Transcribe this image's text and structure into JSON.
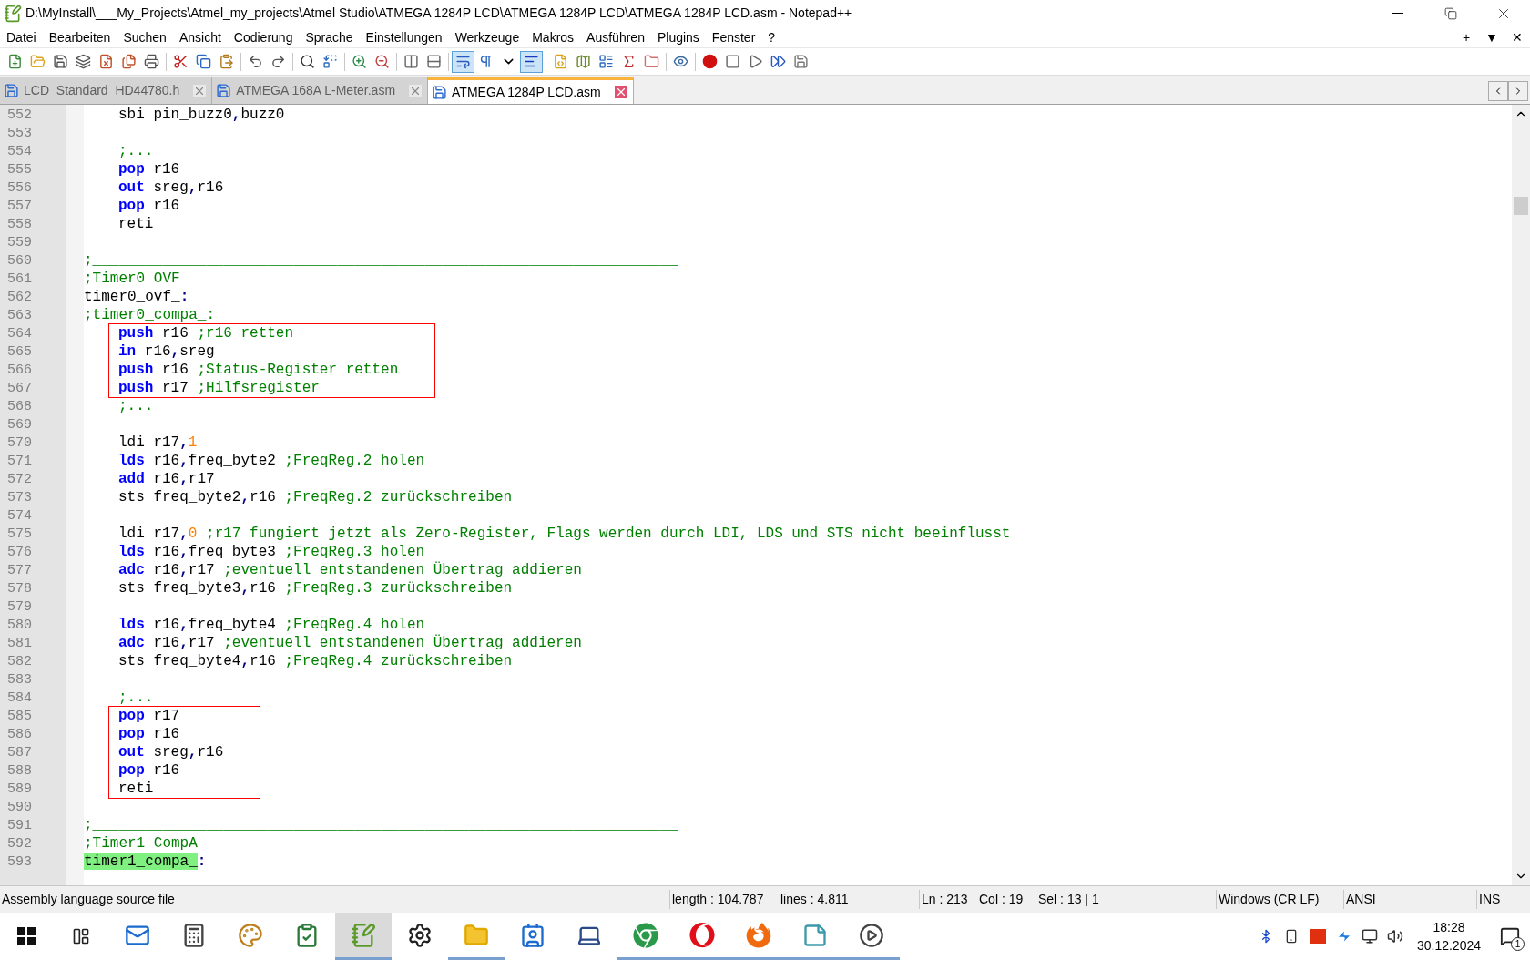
{
  "window": {
    "title": "D:\\MyInstall\\___My_Projects\\Atmel_my_projects\\Atmel Studio\\ATMEGA 1284P LCD\\ATMEGA 1284P LCD\\ATMEGA 1284P LCD.asm - Notepad++"
  },
  "menu": [
    "Datei",
    "Bearbeiten",
    "Suchen",
    "Ansicht",
    "Codierung",
    "Sprache",
    "Einstellungen",
    "Werkzeuge",
    "Makros",
    "Ausführen",
    "Plugins",
    "Fenster",
    "?"
  ],
  "menu_right": [
    "+",
    "▼",
    "✕"
  ],
  "toolbar": [
    [
      {
        "kind": "new",
        "pressed": false
      },
      {
        "kind": "open",
        "pressed": false
      },
      {
        "kind": "save",
        "pressed": false
      },
      {
        "kind": "save_all",
        "pressed": false
      },
      {
        "kind": "close",
        "pressed": false
      },
      {
        "kind": "close_all",
        "pressed": false
      },
      {
        "kind": "print",
        "pressed": false
      }
    ],
    [
      {
        "kind": "cut",
        "pressed": false
      },
      {
        "kind": "copy",
        "pressed": false
      },
      {
        "kind": "paste",
        "pressed": false
      }
    ],
    [
      {
        "kind": "undo",
        "pressed": false
      },
      {
        "kind": "redo",
        "pressed": false
      }
    ],
    [
      {
        "kind": "find",
        "pressed": false
      },
      {
        "kind": "replace",
        "pressed": false
      }
    ],
    [
      {
        "kind": "zoom_in",
        "pressed": false
      },
      {
        "kind": "zoom_out",
        "pressed": false
      }
    ],
    [
      {
        "kind": "sync_v",
        "pressed": false
      },
      {
        "kind": "sync_h",
        "pressed": false
      }
    ],
    [
      {
        "kind": "wrap",
        "pressed": true
      },
      {
        "kind": "all_chars",
        "pressed": false
      },
      {
        "kind": "dropdown",
        "pressed": false
      },
      {
        "kind": "indent_guide",
        "pressed": true
      }
    ],
    [
      {
        "kind": "udl",
        "pressed": false
      },
      {
        "kind": "doc_map",
        "pressed": false
      },
      {
        "kind": "doc_list",
        "pressed": false
      },
      {
        "kind": "function_list",
        "pressed": false
      },
      {
        "kind": "folder",
        "pressed": false
      }
    ],
    [
      {
        "kind": "monitor",
        "pressed": false
      }
    ],
    [
      {
        "kind": "record",
        "pressed": false
      },
      {
        "kind": "stop",
        "pressed": false
      },
      {
        "kind": "play",
        "pressed": false
      },
      {
        "kind": "play_multi",
        "pressed": false
      },
      {
        "kind": "save_macro",
        "pressed": false
      }
    ]
  ],
  "tabs": [
    {
      "label": "LCD_Standard_HD44780.h",
      "selected": false
    },
    {
      "label": "ATMEGA 168A L-Meter.asm",
      "selected": false
    },
    {
      "label": "ATMEGA 1284P LCD.asm",
      "selected": true
    }
  ],
  "code": {
    "lines": [
      {
        "number": "552",
        "indented": true,
        "boxed": false,
        "tokens": [
          {
            "kind": "plain",
            "text": "sbi pin_buzz0"
          },
          {
            "kind": "op",
            "text": ","
          },
          {
            "kind": "plain",
            "text": "buzz0"
          }
        ]
      },
      {
        "number": "553",
        "boxed": false
      },
      {
        "number": "554",
        "indented": true,
        "boxed": false,
        "tokens": [
          {
            "kind": "comment",
            "text": ";..."
          }
        ]
      },
      {
        "number": "555",
        "indented": true,
        "boxed": false,
        "tokens": [
          {
            "kind": "keyword",
            "text": "pop"
          },
          {
            "kind": "plain",
            "text": " r16"
          }
        ]
      },
      {
        "number": "556",
        "indented": true,
        "boxed": false,
        "tokens": [
          {
            "kind": "keyword",
            "text": "out"
          },
          {
            "kind": "plain",
            "text": " sreg"
          },
          {
            "kind": "op",
            "text": ","
          },
          {
            "kind": "plain",
            "text": "r16"
          }
        ]
      },
      {
        "number": "557",
        "indented": true,
        "boxed": false,
        "tokens": [
          {
            "kind": "keyword",
            "text": "pop"
          },
          {
            "kind": "plain",
            "text": " r16"
          }
        ]
      },
      {
        "number": "558",
        "indented": true,
        "boxed": false,
        "tokens": [
          {
            "kind": "plain",
            "text": "reti"
          }
        ]
      },
      {
        "number": "559",
        "boxed": false
      },
      {
        "number": "560",
        "indented": false,
        "boxed": false,
        "tokens": [
          {
            "kind": "comment",
            "text": ";___________________________________________________________________"
          }
        ]
      },
      {
        "number": "561",
        "indented": false,
        "boxed": false,
        "tokens": [
          {
            "kind": "comment",
            "text": ";Timer0 OVF"
          }
        ]
      },
      {
        "number": "562",
        "indented": false,
        "boxed": false,
        "tokens": [
          {
            "kind": "plain",
            "text": "timer0_ovf_"
          },
          {
            "kind": "op",
            "text": ":"
          }
        ]
      },
      {
        "number": "563",
        "indented": false,
        "boxed": false,
        "tokens": [
          {
            "kind": "comment",
            "text": ";timer0_compa_:"
          }
        ]
      },
      {
        "number": "564",
        "indented": true,
        "boxed": true,
        "tokens": [
          {
            "kind": "keyword",
            "text": "push"
          },
          {
            "kind": "plain",
            "text": " r16 "
          },
          {
            "kind": "comment",
            "text": ";r16 retten"
          }
        ]
      },
      {
        "number": "565",
        "indented": true,
        "boxed": true,
        "tokens": [
          {
            "kind": "keyword",
            "text": "in"
          },
          {
            "kind": "plain",
            "text": " r16"
          },
          {
            "kind": "op",
            "text": ","
          },
          {
            "kind": "plain",
            "text": "sreg"
          }
        ]
      },
      {
        "number": "566",
        "indented": true,
        "boxed": true,
        "tokens": [
          {
            "kind": "keyword",
            "text": "push"
          },
          {
            "kind": "plain",
            "text": " r16 "
          },
          {
            "kind": "comment",
            "text": ";Status-Register retten"
          }
        ]
      },
      {
        "number": "567",
        "indented": true,
        "boxed": true,
        "tokens": [
          {
            "kind": "keyword",
            "text": "push"
          },
          {
            "kind": "plain",
            "text": " r17 "
          },
          {
            "kind": "comment",
            "text": ";Hilfsregister"
          }
        ]
      },
      {
        "number": "568",
        "indented": true,
        "boxed": false,
        "tokens": [
          {
            "kind": "comment",
            "text": ";..."
          }
        ]
      },
      {
        "number": "569",
        "boxed": false
      },
      {
        "number": "570",
        "indented": true,
        "boxed": false,
        "tokens": [
          {
            "kind": "plain",
            "text": "ldi r17"
          },
          {
            "kind": "op",
            "text": ","
          },
          {
            "kind": "number",
            "text": "1"
          }
        ]
      },
      {
        "number": "571",
        "indented": true,
        "boxed": false,
        "tokens": [
          {
            "kind": "keyword",
            "text": "lds"
          },
          {
            "kind": "plain",
            "text": " r16"
          },
          {
            "kind": "op",
            "text": ","
          },
          {
            "kind": "plain",
            "text": "freq_byte2 "
          },
          {
            "kind": "comment",
            "text": ";FreqReg.2 holen"
          }
        ]
      },
      {
        "number": "572",
        "indented": true,
        "boxed": false,
        "tokens": [
          {
            "kind": "keyword",
            "text": "add"
          },
          {
            "kind": "plain",
            "text": " r16"
          },
          {
            "kind": "op",
            "text": ","
          },
          {
            "kind": "plain",
            "text": "r17"
          }
        ]
      },
      {
        "number": "573",
        "indented": true,
        "boxed": false,
        "tokens": [
          {
            "kind": "plain",
            "text": "sts freq_byte2"
          },
          {
            "kind": "op",
            "text": ","
          },
          {
            "kind": "plain",
            "text": "r16 "
          },
          {
            "kind": "comment",
            "text": ";FreqReg.2 zurückschreiben"
          }
        ]
      },
      {
        "number": "574",
        "boxed": false
      },
      {
        "number": "575",
        "indented": true,
        "boxed": false,
        "tokens": [
          {
            "kind": "plain",
            "text": "ldi r17"
          },
          {
            "kind": "op",
            "text": ","
          },
          {
            "kind": "number",
            "text": "0"
          },
          {
            "kind": "comment",
            "text": " ;r17 fungiert jetzt als Zero-Register, Flags werden durch LDI, LDS und STS nicht beeinflusst"
          }
        ]
      },
      {
        "number": "576",
        "indented": true,
        "boxed": false,
        "tokens": [
          {
            "kind": "keyword",
            "text": "lds"
          },
          {
            "kind": "plain",
            "text": " r16"
          },
          {
            "kind": "op",
            "text": ","
          },
          {
            "kind": "plain",
            "text": "freq_byte3 "
          },
          {
            "kind": "comment",
            "text": ";FreqReg.3 holen"
          }
        ]
      },
      {
        "number": "577",
        "indented": true,
        "boxed": false,
        "tokens": [
          {
            "kind": "keyword",
            "text": "adc"
          },
          {
            "kind": "plain",
            "text": " r16"
          },
          {
            "kind": "op",
            "text": ","
          },
          {
            "kind": "plain",
            "text": "r17 "
          },
          {
            "kind": "comment",
            "text": ";eventuell entstandenen Übertrag addieren"
          }
        ]
      },
      {
        "number": "578",
        "indented": true,
        "boxed": false,
        "tokens": [
          {
            "kind": "plain",
            "text": "sts freq_byte3"
          },
          {
            "kind": "op",
            "text": ","
          },
          {
            "kind": "plain",
            "text": "r16 "
          },
          {
            "kind": "comment",
            "text": ";FreqReg.3 zurückschreiben"
          }
        ]
      },
      {
        "number": "579",
        "boxed": false
      },
      {
        "number": "580",
        "indented": true,
        "boxed": false,
        "tokens": [
          {
            "kind": "keyword",
            "text": "lds"
          },
          {
            "kind": "plain",
            "text": " r16"
          },
          {
            "kind": "op",
            "text": ","
          },
          {
            "kind": "plain",
            "text": "freq_byte4 "
          },
          {
            "kind": "comment",
            "text": ";FreqReg.4 holen"
          }
        ]
      },
      {
        "number": "581",
        "indented": true,
        "boxed": false,
        "tokens": [
          {
            "kind": "keyword",
            "text": "adc"
          },
          {
            "kind": "plain",
            "text": " r16"
          },
          {
            "kind": "op",
            "text": ","
          },
          {
            "kind": "plain",
            "text": "r17 "
          },
          {
            "kind": "comment",
            "text": ";eventuell entstandenen Übertrag addieren"
          }
        ]
      },
      {
        "number": "582",
        "indented": true,
        "boxed": false,
        "tokens": [
          {
            "kind": "plain",
            "text": "sts freq_byte4"
          },
          {
            "kind": "op",
            "text": ","
          },
          {
            "kind": "plain",
            "text": "r16 "
          },
          {
            "kind": "comment",
            "text": ";FreqReg.4 zurückschreiben"
          }
        ]
      },
      {
        "number": "583",
        "boxed": false
      },
      {
        "number": "584",
        "indented": true,
        "boxed": false,
        "tokens": [
          {
            "kind": "comment",
            "text": ";..."
          }
        ]
      },
      {
        "number": "585",
        "indented": true,
        "boxed": true,
        "tokens": [
          {
            "kind": "keyword",
            "text": "pop"
          },
          {
            "kind": "plain",
            "text": " r17"
          }
        ]
      },
      {
        "number": "586",
        "indented": true,
        "boxed": true,
        "tokens": [
          {
            "kind": "keyword",
            "text": "pop"
          },
          {
            "kind": "plain",
            "text": " r16"
          }
        ]
      },
      {
        "number": "587",
        "indented": true,
        "boxed": true,
        "tokens": [
          {
            "kind": "keyword",
            "text": "out"
          },
          {
            "kind": "plain",
            "text": " sreg"
          },
          {
            "kind": "op",
            "text": ","
          },
          {
            "kind": "plain",
            "text": "r16"
          }
        ]
      },
      {
        "number": "588",
        "indented": true,
        "boxed": true,
        "tokens": [
          {
            "kind": "keyword",
            "text": "pop"
          },
          {
            "kind": "plain",
            "text": " r16"
          }
        ]
      },
      {
        "number": "589",
        "indented": true,
        "boxed": true,
        "tokens": [
          {
            "kind": "plain",
            "text": "reti"
          }
        ]
      },
      {
        "number": "590",
        "boxed": false
      },
      {
        "number": "591",
        "indented": false,
        "boxed": false,
        "tokens": [
          {
            "kind": "comment",
            "text": ";___________________________________________________________________"
          }
        ]
      },
      {
        "number": "592",
        "indented": false,
        "boxed": false,
        "tokens": [
          {
            "kind": "comment",
            "text": ";Timer1 CompA"
          }
        ]
      },
      {
        "number": "593",
        "indented": false,
        "boxed": false,
        "tokens": [
          {
            "kind": "label",
            "text": "timer1_compa_"
          },
          {
            "kind": "op",
            "text": ":"
          }
        ]
      }
    ]
  },
  "status_bar": {
    "file_type": "Assembly language source file",
    "length": "length : 104.787",
    "lines": "lines : 4.811",
    "ln": "Ln : 213",
    "col": "Col : 19",
    "sel": "Sel : 13 | 1",
    "eol": "Windows (CR LF)",
    "encoding": "ANSI",
    "mode": "INS"
  },
  "taskbar": {
    "apps": [
      {
        "kind": "mail",
        "running": false,
        "selected": false
      },
      {
        "kind": "calculator",
        "running": false,
        "selected": false
      },
      {
        "kind": "paint",
        "running": false,
        "selected": false
      },
      {
        "kind": "checklist",
        "running": false,
        "selected": false
      },
      {
        "kind": "notepad",
        "running": true,
        "selected": true
      },
      {
        "kind": "settings",
        "running": false,
        "selected": false
      },
      {
        "kind": "explorer",
        "running": true,
        "selected": false
      },
      {
        "kind": "card",
        "running": false,
        "selected": false
      },
      {
        "kind": "laptop",
        "running": false,
        "selected": false
      },
      {
        "kind": "chrome",
        "running": true,
        "selected": false
      },
      {
        "kind": "opera",
        "running": true,
        "selected": false
      },
      {
        "kind": "firefox",
        "running": true,
        "selected": false
      },
      {
        "kind": "notes",
        "running": true,
        "selected": false
      },
      {
        "kind": "media",
        "running": true,
        "selected": false
      }
    ],
    "time": "18:28",
    "date": "30.12.2024",
    "notifications": "1"
  }
}
